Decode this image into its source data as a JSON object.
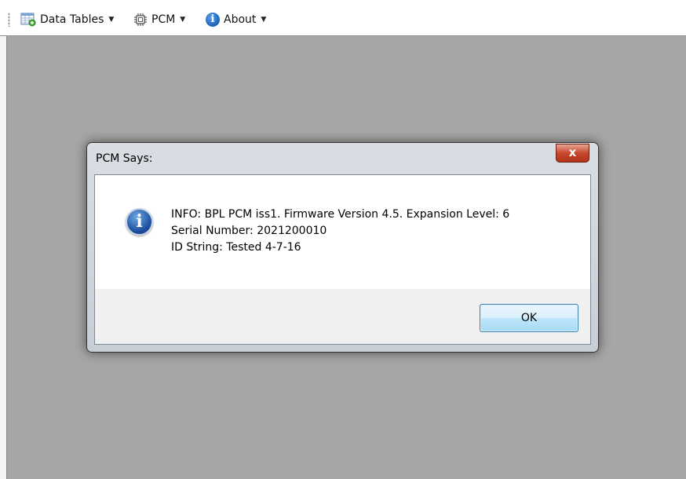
{
  "toolbar": {
    "data_tables": "Data Tables",
    "pcm": "PCM",
    "about": "About",
    "caret": "▼"
  },
  "dialog": {
    "title": "PCM Says:",
    "close_label": "x",
    "info_glyph": "i",
    "lines": [
      "INFO: BPL PCM iss1. Firmware Version 4.5. Expansion Level: 6",
      "Serial Number: 2021200010",
      "ID String: Tested 4-7-16"
    ],
    "ok_label": "OK"
  },
  "icons": {
    "data_tables": "table-icon",
    "pcm": "chip-icon",
    "about": "info-icon",
    "message": "info-icon"
  },
  "colors": {
    "workspace": "#a6a6a6",
    "close_button": "#c8472d",
    "ok_button": "#bee6fd"
  }
}
